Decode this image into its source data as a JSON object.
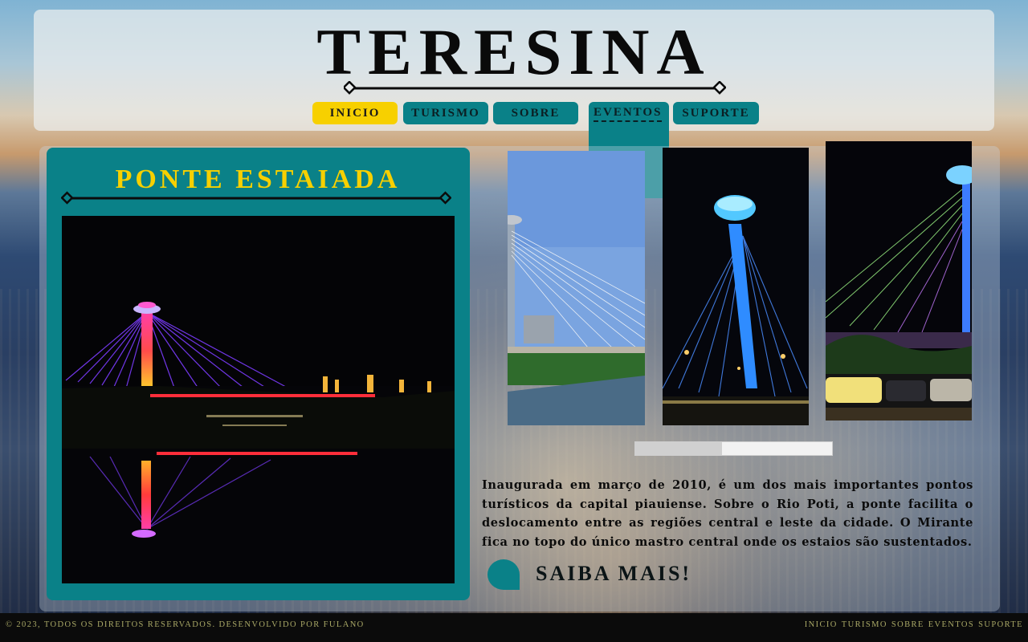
{
  "site": {
    "title": "TERESINA"
  },
  "nav": {
    "items": [
      {
        "label": "INICIO",
        "active": true
      },
      {
        "label": "TURISMO",
        "active": false
      },
      {
        "label": "SOBRE",
        "active": false
      },
      {
        "label": "EVENTOS",
        "active": false
      },
      {
        "label": "SUPORTE",
        "active": false
      }
    ]
  },
  "feature": {
    "title": "PONTE ESTAIADA",
    "description": "Inaugurada em março de 2010, é um dos mais importantes pontos turísticos da capital piauiense. Sobre o Rio Poti, a ponte facilita o deslocamento entre as regiões central e leste da cidade. O Mirante fica no topo do único mastro central onde os estaios são sustentados.",
    "more_label": "SAIBA MAIS!",
    "gallery_progress": 0.44
  },
  "footer": {
    "copyright": "© 2023, TODOS OS DIREITOS RESERVADOS. DESENVOLVIDO POR FULANO",
    "links": [
      "INICIO",
      "TURISMO",
      "SOBRE",
      "EVENTOS",
      "SUPORTE"
    ]
  },
  "colors": {
    "teal": "#0a8188",
    "yellow": "#f7d000",
    "footer_bg": "#0b0b0b",
    "footer_text": "#a9a866"
  }
}
